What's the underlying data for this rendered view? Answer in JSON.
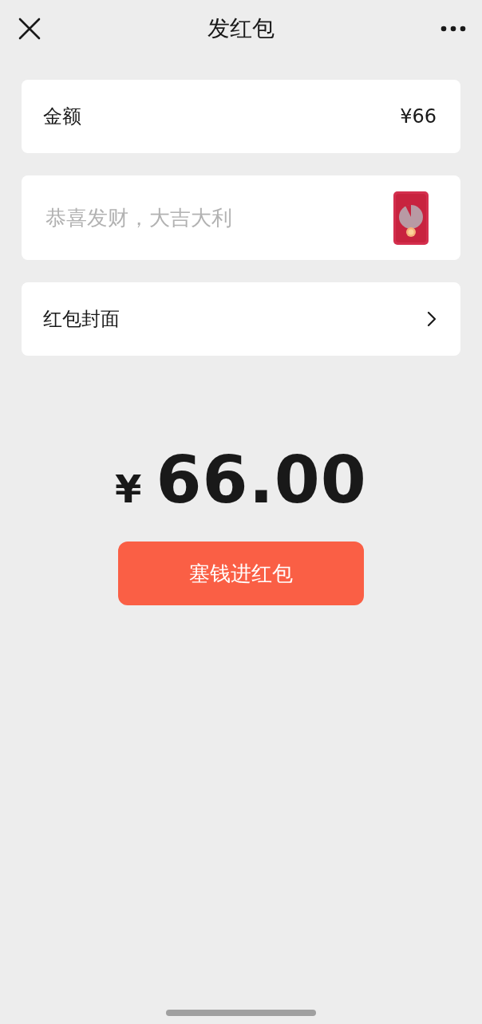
{
  "header": {
    "title": "发红包"
  },
  "amount_field": {
    "label": "金额",
    "value": "¥66"
  },
  "message_field": {
    "placeholder": "恭喜发财，大吉大利"
  },
  "cover_row": {
    "label": "红包封面"
  },
  "total": {
    "currency": "¥",
    "amount": "66.00"
  },
  "submit_button": {
    "label": "塞钱进红包"
  }
}
